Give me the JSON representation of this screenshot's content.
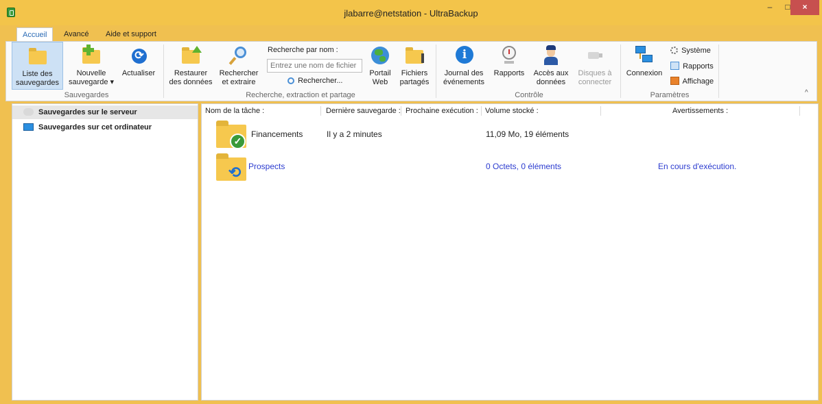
{
  "window": {
    "title": "jlabarre@netstation - UltraBackup",
    "minimize": "–",
    "maximize": "□",
    "close": "×"
  },
  "tabs": [
    "Accueil",
    "Avancé",
    "Aide et support"
  ],
  "ribbon": {
    "sauvegardes": {
      "label": "Sauvegardes",
      "liste": "Liste des sauvegardes",
      "liste_l1": "Liste des",
      "liste_l2": "sauvegardes",
      "nouvelle_l1": "Nouvelle",
      "nouvelle_l2": "sauvegarde ▾",
      "actualiser": "Actualiser"
    },
    "recherche": {
      "label": "Recherche, extraction et partage",
      "restaurer_l1": "Restaurer",
      "restaurer_l2": "des données",
      "rechercher_l1": "Rechercher",
      "rechercher_l2": "et extraire",
      "search_label": "Recherche par nom :",
      "search_placeholder": "Entrez une nom de fichier",
      "search_button": "Rechercher...",
      "portail_l1": "Portail",
      "portail_l2": "Web",
      "fichiers_l1": "Fichiers",
      "fichiers_l2": "partagés"
    },
    "controle": {
      "label": "Contrôle",
      "journal_l1": "Journal des",
      "journal_l2": "événements",
      "rapports": "Rapports",
      "acces_l1": "Accès aux",
      "acces_l2": "données",
      "disques_l1": "Disques à",
      "disques_l2": "connecter"
    },
    "parametres": {
      "label": "Paramètres",
      "connexion": "Connexion",
      "systeme": "Système",
      "rapports": "Rapports",
      "affichage": "Affichage"
    },
    "collapse": "^"
  },
  "left_pane": {
    "items": [
      {
        "label": "Sauvegardes sur le serveur"
      },
      {
        "label": "Sauvegardes sur cet ordinateur"
      }
    ]
  },
  "table": {
    "headers": [
      "Nom de la tâche :",
      "Dernière sauvegarde :",
      "Prochaine exécution :",
      "Volume stocké :",
      "Avertissements :"
    ],
    "rows": [
      {
        "name": "Financements",
        "last": "Il y a 2 minutes",
        "next": "",
        "volume": "11,09 Mo, 19 éléments",
        "warning": "",
        "status": "ok"
      },
      {
        "name": "Prospects",
        "last": "",
        "next": "",
        "volume": "0 Octets, 0 éléments",
        "warning": "En cours d'exécution.",
        "status": "running"
      }
    ]
  },
  "colors": {
    "titlebar": "#f3c44a",
    "accent": "#2b6bb5",
    "running": "#2b3bcf",
    "close": "#c7504f"
  }
}
